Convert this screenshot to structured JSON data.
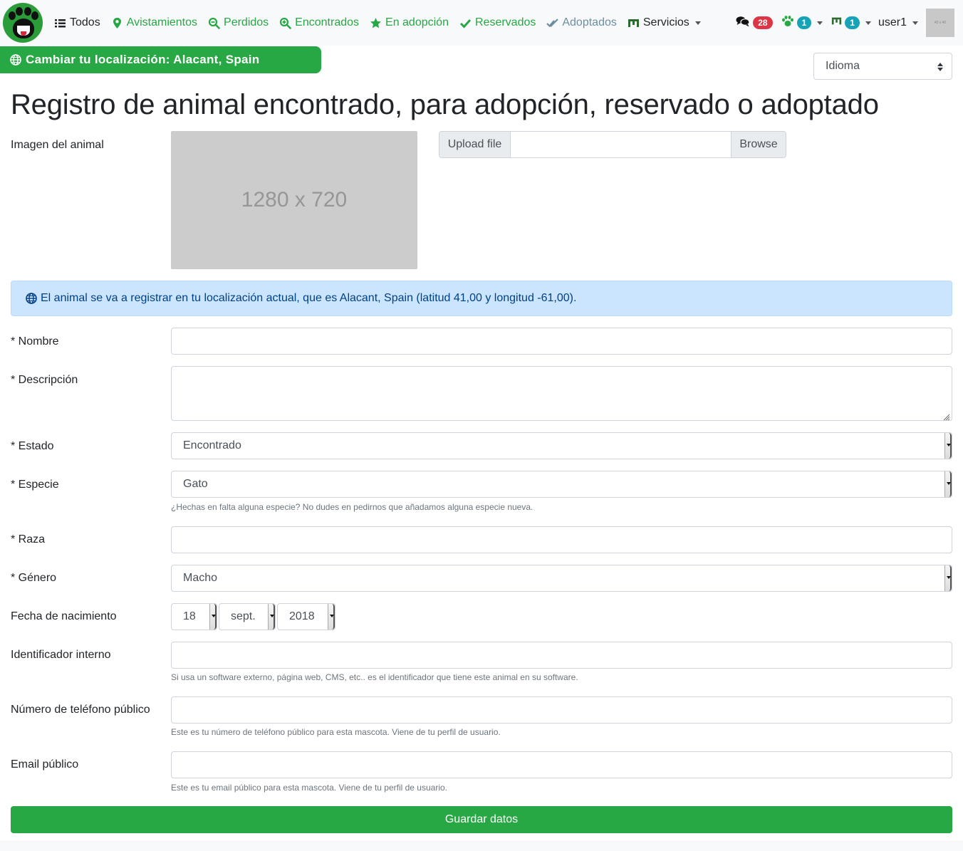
{
  "nav": {
    "items": [
      {
        "label": "Todos",
        "icon": "list-icon"
      },
      {
        "label": "Avistamientos",
        "icon": "map-marker-icon"
      },
      {
        "label": "Perdidos",
        "icon": "search-minus-icon"
      },
      {
        "label": "Encontrados",
        "icon": "search-plus-icon"
      },
      {
        "label": "En adopción",
        "icon": "star-icon"
      },
      {
        "label": "Reservados",
        "icon": "check-icon"
      },
      {
        "label": "Adoptados",
        "icon": "double-check-icon"
      },
      {
        "label": "Servicios",
        "icon": "shop-icon"
      }
    ],
    "messages_count": "28",
    "paw_count": "1",
    "shop_count": "1",
    "user_name": "user1",
    "avatar_text": "40 x 40"
  },
  "location_bar": {
    "label": "Cambiar tu localización: Alacant, Spain"
  },
  "language_select": {
    "label": "Idioma"
  },
  "page_title": "Registro de animal encontrado, para adopción, reservado o adoptado",
  "form": {
    "image_label": "Imagen del animal",
    "image_placeholder_text": "1280 x 720",
    "upload_label": "Upload file",
    "browse_label": "Browse",
    "location_alert": "El animal se va a registrar en tu localización actual, que es Alacant, Spain (latitud 41,00 y longitud -61,00).",
    "name_label": "* Nombre",
    "description_label": "* Descripción",
    "status_label": "* Estado",
    "status_value": "Encontrado",
    "species_label": "* Especie",
    "species_value": "Gato",
    "species_help": "¿Hechas en falta alguna especie? No dudes en pedirnos que añadamos alguna especie nueva.",
    "breed_label": "* Raza",
    "gender_label": "* Género",
    "gender_value": "Macho",
    "birthdate_label": "Fecha de nacimiento",
    "birth_day": "18",
    "birth_month": "sept.",
    "birth_year": "2018",
    "internal_id_label": "Identificador interno",
    "internal_id_help": "Si usa un software externo, página web, CMS, etc.. es el identificador que tiene este animal en su software.",
    "phone_label": "Número de teléfono público",
    "phone_help": "Este es tu número de teléfono público para esta mascota. Viene de tu perfil de usuario.",
    "email_label": "Email público",
    "email_help": "Este es tu email público para esta mascota. Viene de tu perfil de usuario.",
    "save_label": "Guardar datos"
  },
  "colors": {
    "primary_green": "#28a745",
    "alert_bg": "#cce5ff",
    "alert_text": "#004085",
    "badge_red": "#dc3545",
    "badge_teal": "#17a2b8"
  }
}
